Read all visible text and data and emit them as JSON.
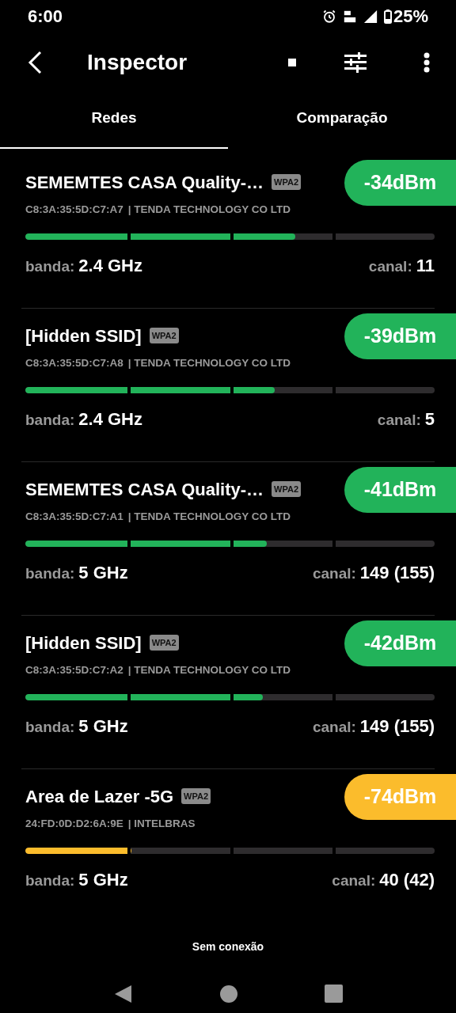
{
  "status_bar": {
    "time": "6:00",
    "battery": "25%"
  },
  "header": {
    "title": "Inspector"
  },
  "tabs": [
    {
      "label": "Redes",
      "selected": true
    },
    {
      "label": "Comparação",
      "selected": false
    }
  ],
  "networks": [
    {
      "ssid": "SEMEMTES CASA Quality-…",
      "security": "WPA2",
      "signal": "-34dBm",
      "color": "#22b35a",
      "mac": "C8:3A:35:5D:C7:A7",
      "vendor": "| TENDA TECHNOLOGY CO LTD",
      "level": 0.66,
      "band_label": "banda:",
      "band": "2.4 GHz",
      "channel_label": "canal:",
      "channel": "11"
    },
    {
      "ssid": "[Hidden SSID]",
      "security": "WPA2",
      "signal": "-39dBm",
      "color": "#22b35a",
      "mac": "C8:3A:35:5D:C7:A8",
      "vendor": "| TENDA TECHNOLOGY CO LTD",
      "level": 0.61,
      "band_label": "banda:",
      "band": "2.4 GHz",
      "channel_label": "canal:",
      "channel": "5"
    },
    {
      "ssid": "SEMEMTES CASA Quality-…",
      "security": "WPA2",
      "signal": "-41dBm",
      "color": "#22b35a",
      "mac": "C8:3A:35:5D:C7:A1",
      "vendor": "| TENDA TECHNOLOGY CO LTD",
      "level": 0.59,
      "band_label": "banda:",
      "band": "5 GHz",
      "channel_label": "canal:",
      "channel": "149 (155)"
    },
    {
      "ssid": "[Hidden SSID]",
      "security": "WPA2",
      "signal": "-42dBm",
      "color": "#22b35a",
      "mac": "C8:3A:35:5D:C7:A2",
      "vendor": "| TENDA TECHNOLOGY CO LTD",
      "level": 0.58,
      "band_label": "banda:",
      "band": "5 GHz",
      "channel_label": "canal:",
      "channel": "149 (155)"
    },
    {
      "ssid": "Area de Lazer -5G",
      "security": "WPA2",
      "signal": "-74dBm",
      "color": "#fbbc2c",
      "mac": "24:FD:0D:D2:6A:9E",
      "vendor": "| INTELBRAS",
      "level": 0.26,
      "band_label": "banda:",
      "band": "5 GHz",
      "channel_label": "canal:",
      "channel": "40 (42)"
    }
  ],
  "footer": {
    "status": "Sem conexão"
  }
}
